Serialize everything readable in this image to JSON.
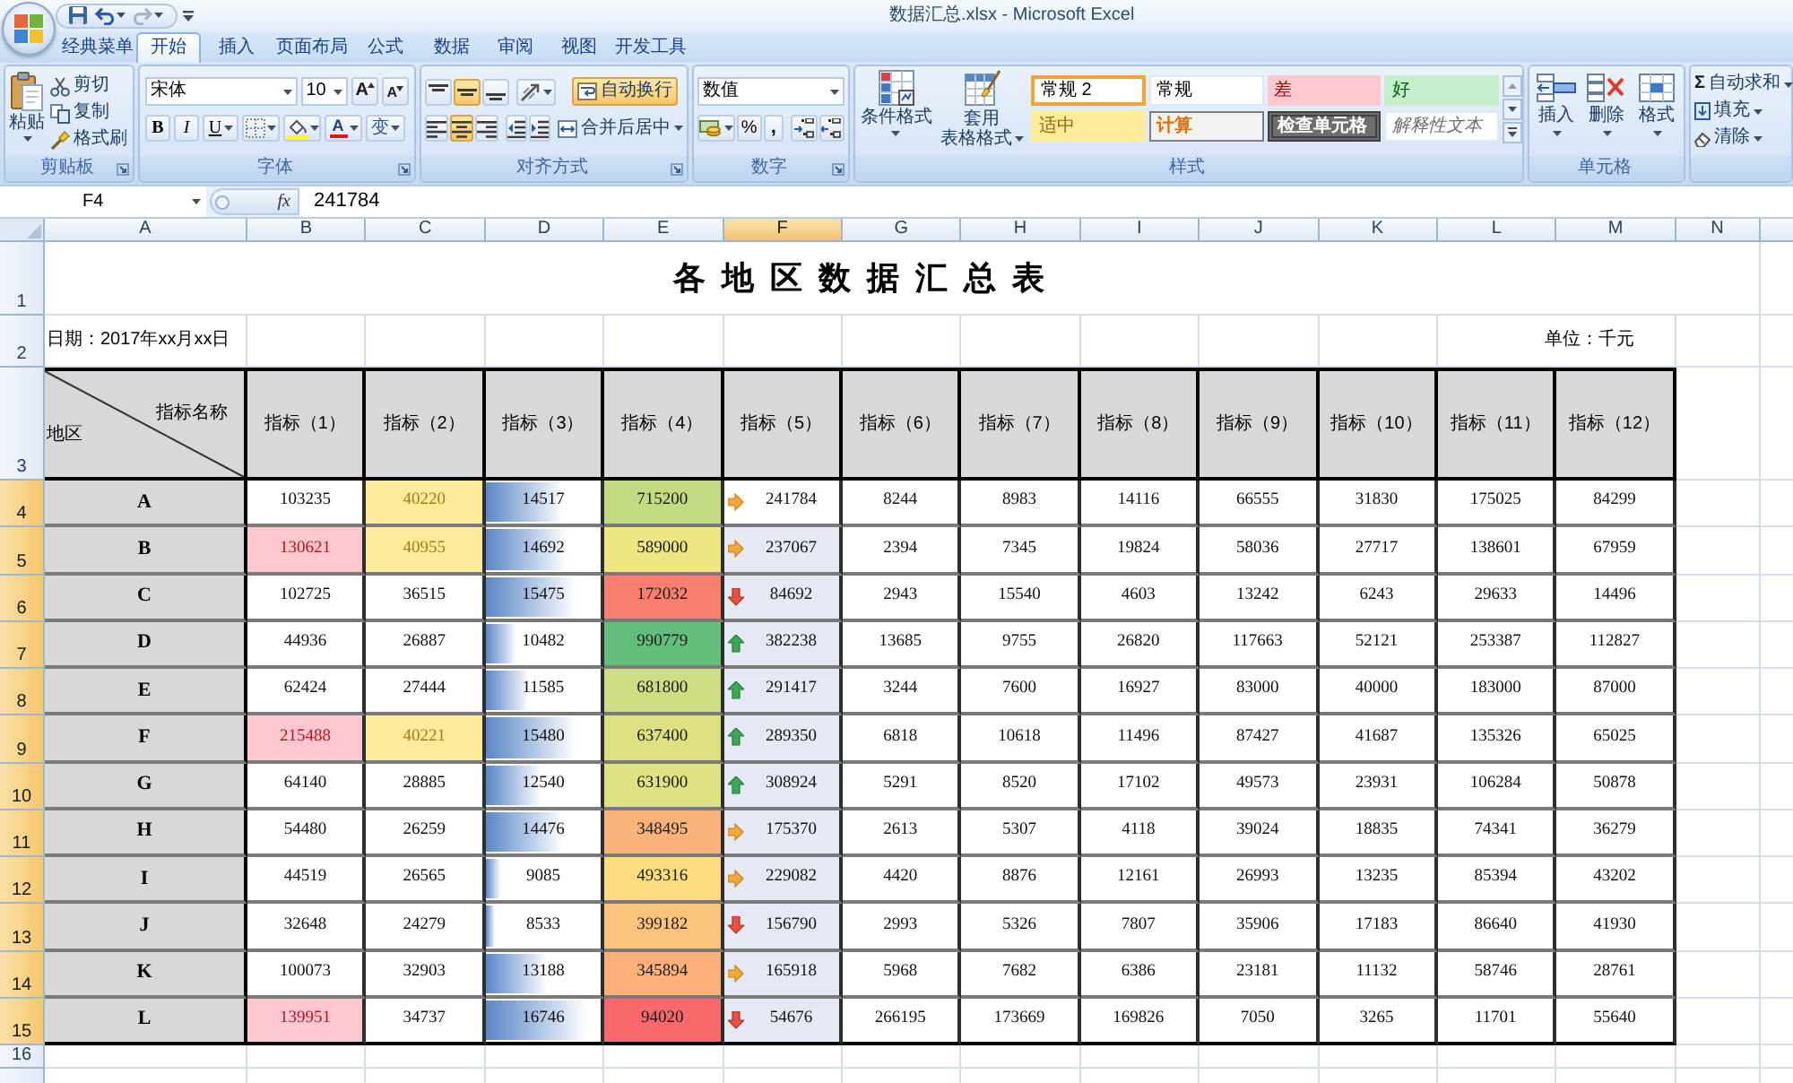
{
  "window": {
    "title": "数据汇总.xlsx - Microsoft Excel"
  },
  "quick_access": [
    {
      "kind": "save",
      "disabled": false
    },
    {
      "kind": "undo",
      "disabled": false
    },
    {
      "kind": "redo",
      "disabled": true
    }
  ],
  "tabs": [
    {
      "label": "经典菜单",
      "selected": false
    },
    {
      "label": "开始",
      "selected": true
    },
    {
      "label": "插入",
      "selected": false
    },
    {
      "label": "页面布局",
      "selected": false
    },
    {
      "label": "公式",
      "selected": false
    },
    {
      "label": "数据",
      "selected": false
    },
    {
      "label": "审阅",
      "selected": false
    },
    {
      "label": "视图",
      "selected": false
    },
    {
      "label": "开发工具",
      "selected": false
    }
  ],
  "ribbon": {
    "clipboard": {
      "label": "剪贴板",
      "paste": "粘贴",
      "cut": "剪切",
      "copy": "复制",
      "format_painter": "格式刷"
    },
    "font": {
      "label": "字体",
      "font_name": "宋体",
      "font_size": "10",
      "grow_font": "A",
      "shrink_font": "A",
      "bold": "B",
      "italic": "I",
      "underline": "U",
      "font_color": "A",
      "phonetic": "变"
    },
    "alignment": {
      "label": "对齐方式",
      "vertical": [
        {
          "kind": "top",
          "selected": false
        },
        {
          "kind": "middle",
          "selected": true
        },
        {
          "kind": "bottom",
          "selected": false
        }
      ],
      "horizontal": [
        {
          "kind": "left",
          "selected": false
        },
        {
          "kind": "center",
          "selected": true
        },
        {
          "kind": "right",
          "selected": false
        }
      ],
      "wrap_text": {
        "label": "自动换行",
        "on": true
      },
      "merge_center": "合并后居中"
    },
    "number": {
      "label": "数字",
      "format": "数值",
      "percent": "%",
      "comma": ","
    },
    "styles": {
      "label": "样式",
      "conditional_formatting": "条件格式",
      "format_as_table": [
        "套用",
        "表格格式"
      ],
      "gallery": [
        {
          "label": "常规 2",
          "kind": "normal",
          "selected": true
        },
        {
          "label": "常规",
          "kind": "normal",
          "selected": false
        },
        {
          "label": "差",
          "kind": "bad",
          "selected": false
        },
        {
          "label": "好",
          "kind": "good",
          "selected": false
        },
        {
          "label": "适中",
          "kind": "neutral",
          "selected": false
        },
        {
          "label": "计算",
          "kind": "calculation",
          "selected": false
        },
        {
          "label": "检查单元格",
          "kind": "check",
          "selected": false
        },
        {
          "label": "解释性文本",
          "kind": "explanatory",
          "selected": false
        }
      ]
    },
    "cells": {
      "label": "单元格",
      "insert": "插入",
      "delete": "删除",
      "format": "格式"
    },
    "editing": {
      "sigma": "Σ",
      "autosum": "自动求和",
      "fill": "填充",
      "clear": "清除"
    }
  },
  "formula_bar": {
    "name_box": "F4",
    "function_label": "fx",
    "formula": "241784"
  },
  "sheet": {
    "column_headers": [
      {
        "label": "A",
        "selected": false
      },
      {
        "label": "B",
        "selected": false
      },
      {
        "label": "C",
        "selected": false
      },
      {
        "label": "D",
        "selected": false
      },
      {
        "label": "E",
        "selected": false
      },
      {
        "label": "F",
        "selected": true
      },
      {
        "label": "G",
        "selected": false
      },
      {
        "label": "H",
        "selected": false
      },
      {
        "label": "I",
        "selected": false
      },
      {
        "label": "J",
        "selected": false
      },
      {
        "label": "K",
        "selected": false
      },
      {
        "label": "L",
        "selected": false
      },
      {
        "label": "M",
        "selected": false
      },
      {
        "label": "N",
        "selected": false
      }
    ],
    "row_headers": [
      {
        "label": "1",
        "selected": false
      },
      {
        "label": "2",
        "selected": false
      },
      {
        "label": "3",
        "selected": false
      },
      {
        "label": "4",
        "selected": true
      },
      {
        "label": "5",
        "selected": true
      },
      {
        "label": "6",
        "selected": true
      },
      {
        "label": "7",
        "selected": true
      },
      {
        "label": "8",
        "selected": true
      },
      {
        "label": "9",
        "selected": true
      },
      {
        "label": "10",
        "selected": true
      },
      {
        "label": "11",
        "selected": true
      },
      {
        "label": "12",
        "selected": true
      },
      {
        "label": "13",
        "selected": true
      },
      {
        "label": "14",
        "selected": true
      },
      {
        "label": "15",
        "selected": true
      },
      {
        "label": "16",
        "selected": false
      }
    ],
    "title": "各 地 区 数 据 汇 总 表",
    "date": "日期：2017年xx月xx日",
    "unit": "单位：千元",
    "corner_header": {
      "top": "指标名称",
      "bottom": "地区"
    },
    "indicators": [
      "指标（1）",
      "指标（2）",
      "指标（3）",
      "指标（4）",
      "指标（5）",
      "指标（6）",
      "指标（7）",
      "指标（8）",
      "指标（9）",
      "指标（10）",
      "指标（11）",
      "指标（12）"
    ],
    "rows": [
      {
        "region": "A",
        "cells": [
          {
            "kind": "plain",
            "text": "103235"
          },
          {
            "kind": "neutral",
            "text": "40220"
          },
          {
            "kind": "databar",
            "text": "14517",
            "level": 0.67
          },
          {
            "kind": "scale",
            "text": "715200",
            "color": "#c3da81"
          },
          {
            "kind": "arrow_right",
            "text": "241784"
          },
          {
            "kind": "plain",
            "text": "8244"
          },
          {
            "kind": "plain",
            "text": "8983"
          },
          {
            "kind": "plain",
            "text": "14116"
          },
          {
            "kind": "plain",
            "text": "66555"
          },
          {
            "kind": "plain",
            "text": "31830"
          },
          {
            "kind": "plain",
            "text": "175025"
          },
          {
            "kind": "plain",
            "text": "84299"
          }
        ]
      },
      {
        "region": "B",
        "cells": [
          {
            "kind": "bad",
            "text": "130621"
          },
          {
            "kind": "neutral",
            "text": "40955"
          },
          {
            "kind": "databar",
            "text": "14692",
            "level": 0.7
          },
          {
            "kind": "scale",
            "text": "589000",
            "color": "#eee683"
          },
          {
            "kind": "arrow_right",
            "text": "237067"
          },
          {
            "kind": "plain",
            "text": "2394"
          },
          {
            "kind": "plain",
            "text": "7345"
          },
          {
            "kind": "plain",
            "text": "19824"
          },
          {
            "kind": "plain",
            "text": "58036"
          },
          {
            "kind": "plain",
            "text": "27717"
          },
          {
            "kind": "plain",
            "text": "138601"
          },
          {
            "kind": "plain",
            "text": "67959"
          }
        ]
      },
      {
        "region": "C",
        "cells": [
          {
            "kind": "plain",
            "text": "102725"
          },
          {
            "kind": "plain",
            "text": "36515"
          },
          {
            "kind": "databar",
            "text": "15475",
            "level": 0.78
          },
          {
            "kind": "scale",
            "text": "172032",
            "color": "#f9806f"
          },
          {
            "kind": "arrow_down",
            "text": "84692"
          },
          {
            "kind": "plain",
            "text": "2943"
          },
          {
            "kind": "plain",
            "text": "15540"
          },
          {
            "kind": "plain",
            "text": "4603"
          },
          {
            "kind": "plain",
            "text": "13242"
          },
          {
            "kind": "plain",
            "text": "6243"
          },
          {
            "kind": "plain",
            "text": "29633"
          },
          {
            "kind": "plain",
            "text": "14496"
          }
        ]
      },
      {
        "region": "D",
        "cells": [
          {
            "kind": "plain",
            "text": "44936"
          },
          {
            "kind": "plain",
            "text": "26887"
          },
          {
            "kind": "databar",
            "text": "10482",
            "level": 0.27
          },
          {
            "kind": "scale",
            "text": "990779",
            "color": "#63be7b"
          },
          {
            "kind": "arrow_up",
            "text": "382238"
          },
          {
            "kind": "plain",
            "text": "13685"
          },
          {
            "kind": "plain",
            "text": "9755"
          },
          {
            "kind": "plain",
            "text": "26820"
          },
          {
            "kind": "plain",
            "text": "117663"
          },
          {
            "kind": "plain",
            "text": "52121"
          },
          {
            "kind": "plain",
            "text": "253387"
          },
          {
            "kind": "plain",
            "text": "112827"
          }
        ]
      },
      {
        "region": "E",
        "cells": [
          {
            "kind": "plain",
            "text": "62424"
          },
          {
            "kind": "plain",
            "text": "27444"
          },
          {
            "kind": "databar",
            "text": "11585",
            "level": 0.38
          },
          {
            "kind": "scale",
            "text": "681800",
            "color": "#cedd81"
          },
          {
            "kind": "arrow_up",
            "text": "291417"
          },
          {
            "kind": "plain",
            "text": "3244"
          },
          {
            "kind": "plain",
            "text": "7600"
          },
          {
            "kind": "plain",
            "text": "16927"
          },
          {
            "kind": "plain",
            "text": "83000"
          },
          {
            "kind": "plain",
            "text": "40000"
          },
          {
            "kind": "plain",
            "text": "183000"
          },
          {
            "kind": "plain",
            "text": "87000"
          }
        ]
      },
      {
        "region": "F",
        "cells": [
          {
            "kind": "bad",
            "text": "215488"
          },
          {
            "kind": "neutral",
            "text": "40221"
          },
          {
            "kind": "databar",
            "text": "15480",
            "level": 0.78
          },
          {
            "kind": "scale",
            "text": "637400",
            "color": "#dee182"
          },
          {
            "kind": "arrow_up",
            "text": "289350"
          },
          {
            "kind": "plain",
            "text": "6818"
          },
          {
            "kind": "plain",
            "text": "10618"
          },
          {
            "kind": "plain",
            "text": "11496"
          },
          {
            "kind": "plain",
            "text": "87427"
          },
          {
            "kind": "plain",
            "text": "41687"
          },
          {
            "kind": "plain",
            "text": "135326"
          },
          {
            "kind": "plain",
            "text": "65025"
          }
        ]
      },
      {
        "region": "G",
        "cells": [
          {
            "kind": "plain",
            "text": "64140"
          },
          {
            "kind": "plain",
            "text": "28885"
          },
          {
            "kind": "databar",
            "text": "12540",
            "level": 0.48
          },
          {
            "kind": "scale",
            "text": "631900",
            "color": "#dfe282"
          },
          {
            "kind": "arrow_up",
            "text": "308924"
          },
          {
            "kind": "plain",
            "text": "5291"
          },
          {
            "kind": "plain",
            "text": "8520"
          },
          {
            "kind": "plain",
            "text": "17102"
          },
          {
            "kind": "plain",
            "text": "49573"
          },
          {
            "kind": "plain",
            "text": "23931"
          },
          {
            "kind": "plain",
            "text": "106284"
          },
          {
            "kind": "plain",
            "text": "50878"
          }
        ]
      },
      {
        "region": "H",
        "cells": [
          {
            "kind": "plain",
            "text": "54480"
          },
          {
            "kind": "plain",
            "text": "26259"
          },
          {
            "kind": "databar",
            "text": "14476",
            "level": 0.67
          },
          {
            "kind": "scale",
            "text": "348495",
            "color": "#fcb379"
          },
          {
            "kind": "arrow_right",
            "text": "175370"
          },
          {
            "kind": "plain",
            "text": "2613"
          },
          {
            "kind": "plain",
            "text": "5307"
          },
          {
            "kind": "plain",
            "text": "4118"
          },
          {
            "kind": "plain",
            "text": "39024"
          },
          {
            "kind": "plain",
            "text": "18835"
          },
          {
            "kind": "plain",
            "text": "74341"
          },
          {
            "kind": "plain",
            "text": "36279"
          }
        ]
      },
      {
        "region": "I",
        "cells": [
          {
            "kind": "plain",
            "text": "44519"
          },
          {
            "kind": "plain",
            "text": "26565"
          },
          {
            "kind": "databar",
            "text": "9085",
            "level": 0.13
          },
          {
            "kind": "scale",
            "text": "493316",
            "color": "#fedd81"
          },
          {
            "kind": "arrow_right",
            "text": "229082"
          },
          {
            "kind": "plain",
            "text": "4420"
          },
          {
            "kind": "plain",
            "text": "8876"
          },
          {
            "kind": "plain",
            "text": "12161"
          },
          {
            "kind": "plain",
            "text": "26993"
          },
          {
            "kind": "plain",
            "text": "13235"
          },
          {
            "kind": "plain",
            "text": "85394"
          },
          {
            "kind": "plain",
            "text": "43202"
          }
        ]
      },
      {
        "region": "J",
        "cells": [
          {
            "kind": "plain",
            "text": "32648"
          },
          {
            "kind": "plain",
            "text": "24279"
          },
          {
            "kind": "databar",
            "text": "8533",
            "level": 0.08
          },
          {
            "kind": "scale",
            "text": "399182",
            "color": "#fdc27c"
          },
          {
            "kind": "arrow_down",
            "text": "156790"
          },
          {
            "kind": "plain",
            "text": "2993"
          },
          {
            "kind": "plain",
            "text": "5326"
          },
          {
            "kind": "plain",
            "text": "7807"
          },
          {
            "kind": "plain",
            "text": "35906"
          },
          {
            "kind": "plain",
            "text": "17183"
          },
          {
            "kind": "plain",
            "text": "86640"
          },
          {
            "kind": "plain",
            "text": "41930"
          }
        ]
      },
      {
        "region": "K",
        "cells": [
          {
            "kind": "plain",
            "text": "100073"
          },
          {
            "kind": "plain",
            "text": "32903"
          },
          {
            "kind": "databar",
            "text": "13188",
            "level": 0.53
          },
          {
            "kind": "scale",
            "text": "345894",
            "color": "#fcb279"
          },
          {
            "kind": "arrow_right",
            "text": "165918"
          },
          {
            "kind": "plain",
            "text": "5968"
          },
          {
            "kind": "plain",
            "text": "7682"
          },
          {
            "kind": "plain",
            "text": "6386"
          },
          {
            "kind": "plain",
            "text": "23181"
          },
          {
            "kind": "plain",
            "text": "11132"
          },
          {
            "kind": "plain",
            "text": "58746"
          },
          {
            "kind": "plain",
            "text": "28761"
          }
        ]
      },
      {
        "region": "L",
        "cells": [
          {
            "kind": "bad",
            "text": "139951"
          },
          {
            "kind": "plain",
            "text": "34737"
          },
          {
            "kind": "databar",
            "text": "16746",
            "level": 0.89
          },
          {
            "kind": "scale",
            "text": "94020",
            "color": "#f8696b"
          },
          {
            "kind": "arrow_down",
            "text": "54676"
          },
          {
            "kind": "plain",
            "text": "266195"
          },
          {
            "kind": "plain",
            "text": "173669"
          },
          {
            "kind": "plain",
            "text": "169826"
          },
          {
            "kind": "plain",
            "text": "7050"
          },
          {
            "kind": "plain",
            "text": "3265"
          },
          {
            "kind": "plain",
            "text": "11701"
          },
          {
            "kind": "plain",
            "text": "55640"
          }
        ]
      }
    ]
  }
}
